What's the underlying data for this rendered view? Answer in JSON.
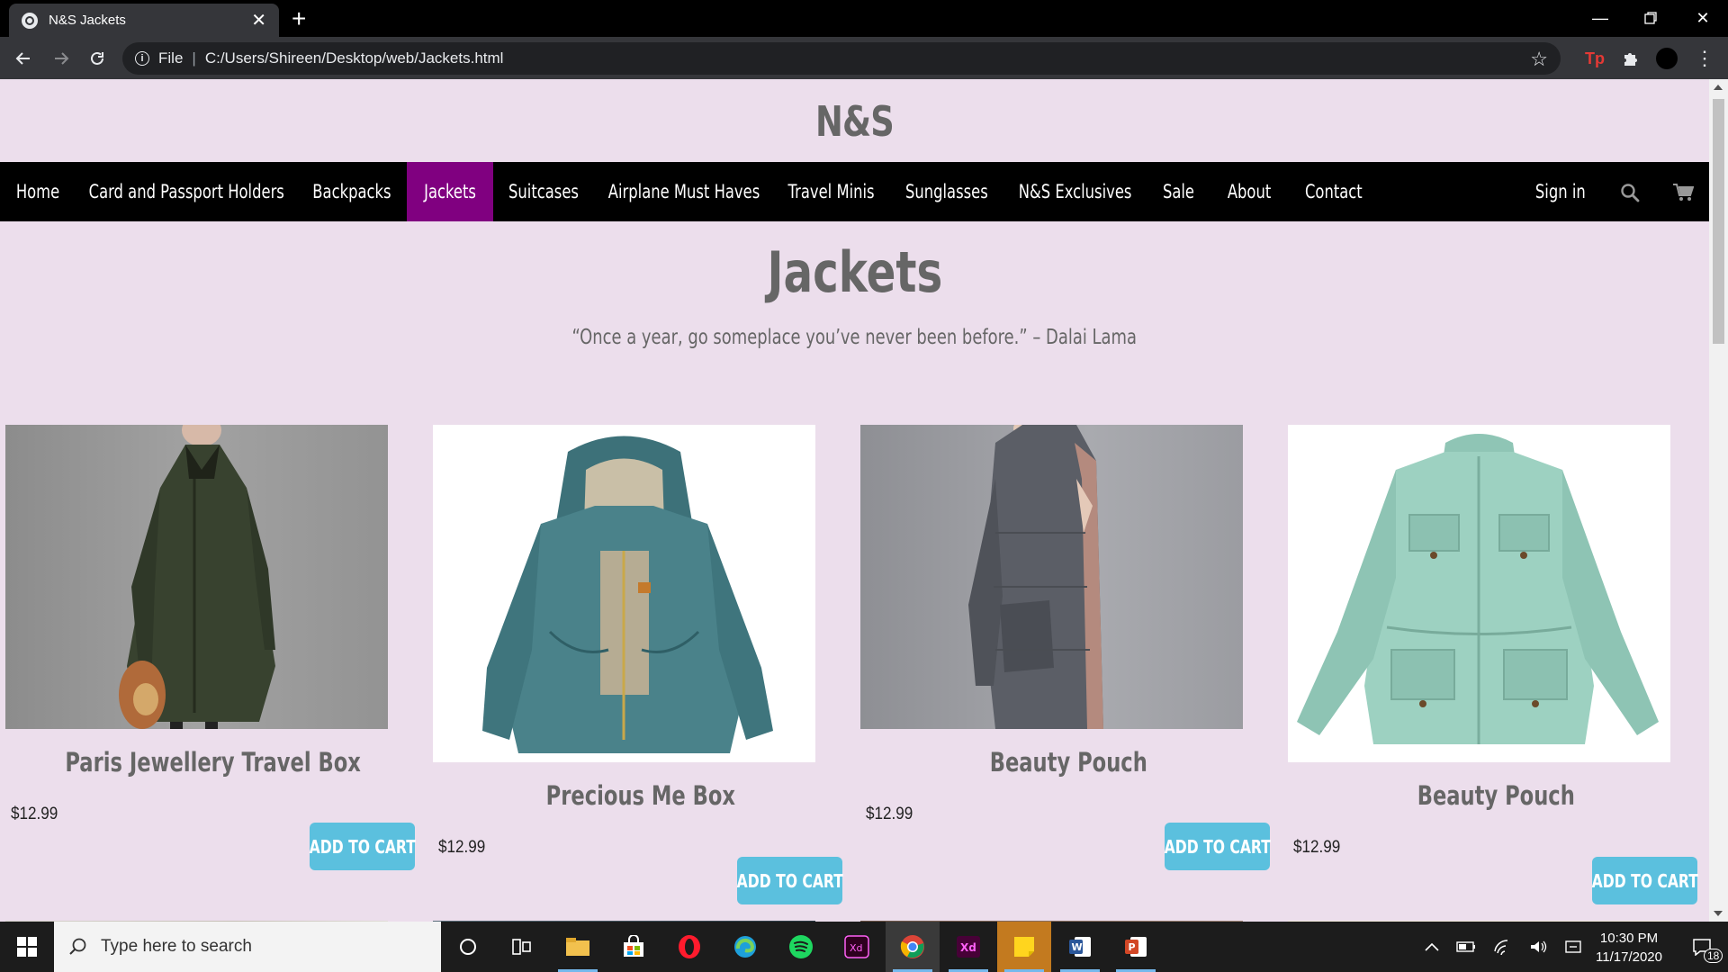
{
  "browser": {
    "tab_title": "N&S Jackets",
    "url_scheme": "File",
    "url_path": "C:/Users/Shireen/Desktop/web/Jackets.html"
  },
  "site": {
    "brand": "N&S",
    "nav": [
      {
        "label": "Home",
        "active": false
      },
      {
        "label": "Card and Passport Holders",
        "active": false
      },
      {
        "label": "Backpacks",
        "active": false
      },
      {
        "label": "Jackets",
        "active": true
      },
      {
        "label": "Suitcases",
        "active": false
      },
      {
        "label": "Airplane Must Haves",
        "active": false
      },
      {
        "label": "Travel Minis",
        "active": false
      },
      {
        "label": "Sunglasses",
        "active": false
      },
      {
        "label": "N&S Exclusives",
        "active": false
      },
      {
        "label": "Sale",
        "active": false
      },
      {
        "label": "About",
        "active": false
      },
      {
        "label": "Contact",
        "active": false
      }
    ],
    "sign_in": "Sign in",
    "page_title": "Jackets",
    "quote": "“Once a year, go someplace you’ve never been before.” – Dalai Lama",
    "accent_color": "#800080",
    "button_color": "#5bc0de"
  },
  "products": [
    {
      "name": "Paris Jewellery Travel Box",
      "price": "$12.99",
      "button": "ADD TO CART",
      "image": "dark-green-parka-photo"
    },
    {
      "name": "Precious Me Box",
      "price": "$12.99",
      "button": "ADD TO CART",
      "image": "teal-hooded-jacket-photo"
    },
    {
      "name": "Beauty Pouch",
      "price": "$12.99",
      "button": "ADD TO CART",
      "image": "grey-puffer-coat-photo"
    },
    {
      "name": "Beauty Pouch",
      "price": "$12.99",
      "button": "ADD TO CART",
      "image": "mint-field-jacket-photo"
    }
  ],
  "taskbar": {
    "search_placeholder": "Type here to search",
    "time": "10:30 PM",
    "date": "11/17/2020",
    "notifications": "18"
  }
}
